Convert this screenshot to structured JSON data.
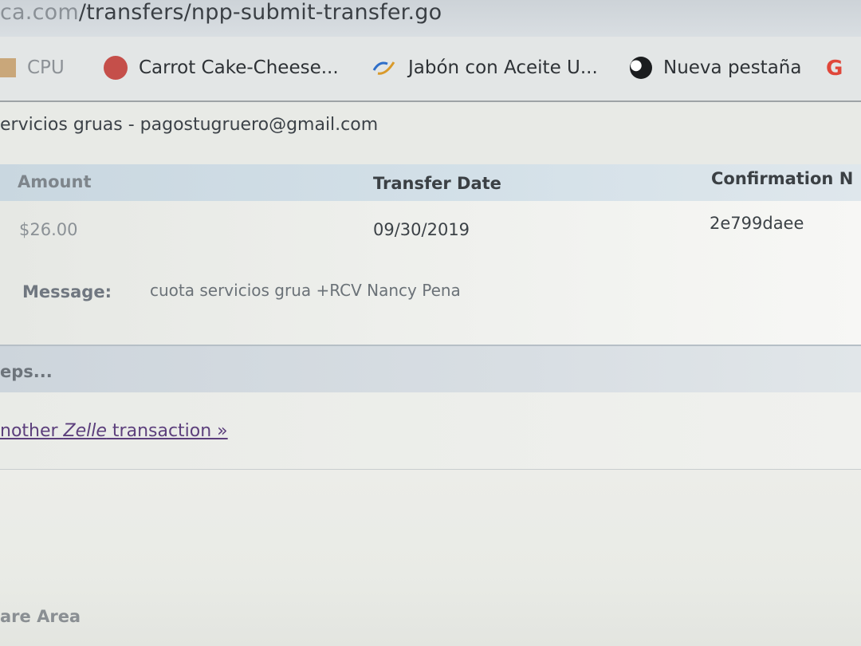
{
  "browser": {
    "url_prefix": "ca.com",
    "url_path": "/transfers/npp-submit-transfer.go"
  },
  "bookmarks": [
    {
      "label": "CPU",
      "icon": "cpu-icon"
    },
    {
      "label": "Carrot Cake-Cheese...",
      "icon": "carrot-cake-icon"
    },
    {
      "label": "Jabón con Aceite U...",
      "icon": "jabon-icon"
    },
    {
      "label": "Nueva pestaña",
      "icon": "globe-icon"
    },
    {
      "label": "G",
      "icon": "google-icon"
    }
  ],
  "payee": {
    "text": "ervicios gruas - pagostugruero@gmail.com"
  },
  "transfer": {
    "headers": {
      "amount": "Amount",
      "date": "Transfer Date",
      "confirmation": "Confirmation N"
    },
    "row": {
      "amount": "$26.00",
      "date": "09/30/2019",
      "confirmation": "2e799daee"
    },
    "message_label": "Message:",
    "message_text": "cuota servicios grua +RCV Nancy Pena"
  },
  "steps_label": "eps...",
  "zelle_link": {
    "prefix": "nother ",
    "brand": "Zelle",
    "suffix": " transaction »"
  },
  "share_area": "are Area",
  "colors": {
    "header_bg": "#d3e0e8",
    "link": "#5c3f7c"
  }
}
